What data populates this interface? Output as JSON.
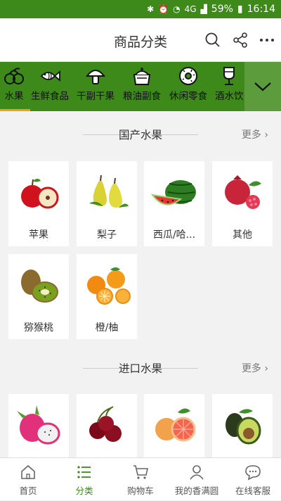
{
  "status_bar": {
    "network": "4G",
    "battery": "59%",
    "time": "16:14"
  },
  "header": {
    "title": "商品分类"
  },
  "categories": [
    {
      "label": "水果",
      "icon": "fruit-icon"
    },
    {
      "label": "生鲜食品",
      "icon": "fish-icon"
    },
    {
      "label": "干副干果",
      "icon": "mushroom-icon"
    },
    {
      "label": "粮油副食",
      "icon": "rice-pot-icon"
    },
    {
      "label": "休闲零食",
      "icon": "donut-icon"
    },
    {
      "label": "酒水饮",
      "icon": "drink-glass-icon"
    }
  ],
  "sections": [
    {
      "title": "国产水果",
      "more": "更多",
      "items": [
        {
          "label": "苹果",
          "icon": "apple-image"
        },
        {
          "label": "梨子",
          "icon": "pear-image"
        },
        {
          "label": "西瓜/哈...",
          "icon": "watermelon-image"
        },
        {
          "label": "其他",
          "icon": "pomegranate-image"
        },
        {
          "label": "猕猴桃",
          "icon": "kiwi-image"
        },
        {
          "label": "橙/柚",
          "icon": "orange-image"
        }
      ]
    },
    {
      "title": "进口水果",
      "more": "更多",
      "items": [
        {
          "label": "",
          "icon": "dragonfruit-image"
        },
        {
          "label": "",
          "icon": "cherry-image"
        },
        {
          "label": "",
          "icon": "grapefruit-image"
        },
        {
          "label": "",
          "icon": "avocado-image"
        }
      ]
    }
  ],
  "tabs": [
    {
      "label": "首页",
      "icon": "home-icon"
    },
    {
      "label": "分类",
      "icon": "list-icon"
    },
    {
      "label": "购物车",
      "icon": "cart-icon"
    },
    {
      "label": "我的香满圆",
      "icon": "person-icon"
    },
    {
      "label": "在线客服",
      "icon": "chat-icon"
    }
  ],
  "colors": {
    "brand_green": "#3d8a1a",
    "active_underline": "#f0a020",
    "page_bg": "#f2f2f2"
  }
}
